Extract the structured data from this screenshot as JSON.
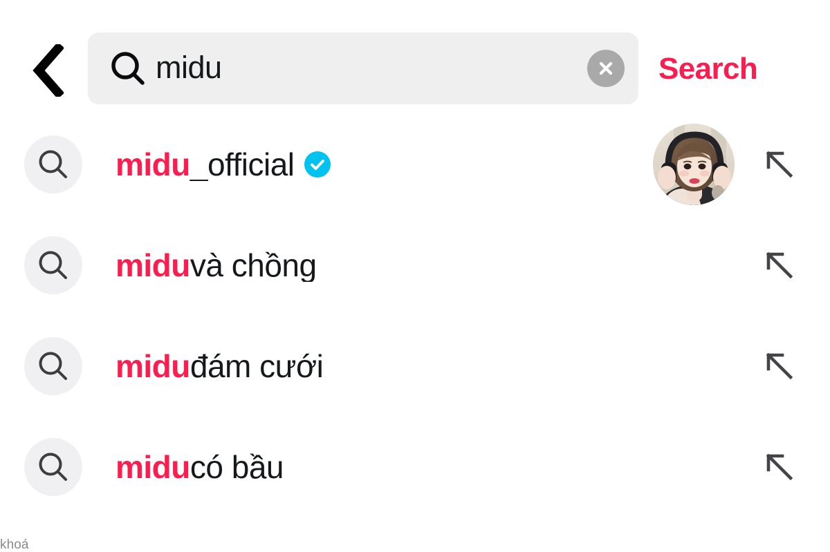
{
  "colors": {
    "accent_pink": "#fa1d50",
    "verified_blue": "#00c2f0",
    "field_bg": "#efeff0",
    "icon_circle_bg": "#f0f0f2",
    "clear_btn_bg": "#a9a9a9",
    "text_primary": "#16181c",
    "caption_gray": "#8a8a8e"
  },
  "header": {
    "back_icon": "chevron-left-icon",
    "search_icon": "search-icon",
    "query": "midu",
    "placeholder": "Search",
    "clear_icon": "close-circle-icon",
    "action_label": "Search"
  },
  "suggestions": [
    {
      "icon": "search-icon",
      "match": "midu",
      "rest": "_official",
      "verified": true,
      "verified_icon": "verified-badge-icon",
      "has_avatar": true,
      "avatar_alt": "midu_official profile photo",
      "arrow_icon": "arrow-up-left-icon"
    },
    {
      "icon": "search-icon",
      "match": "midu",
      "rest": " và chồng",
      "verified": false,
      "has_avatar": false,
      "arrow_icon": "arrow-up-left-icon"
    },
    {
      "icon": "search-icon",
      "match": "midu",
      "rest": " đám cưới",
      "verified": false,
      "has_avatar": false,
      "arrow_icon": "arrow-up-left-icon"
    },
    {
      "icon": "search-icon",
      "match": "midu",
      "rest": " có bầu",
      "verified": false,
      "has_avatar": false,
      "arrow_icon": "arrow-up-left-icon"
    }
  ],
  "footer": {
    "caption": "khoá"
  }
}
